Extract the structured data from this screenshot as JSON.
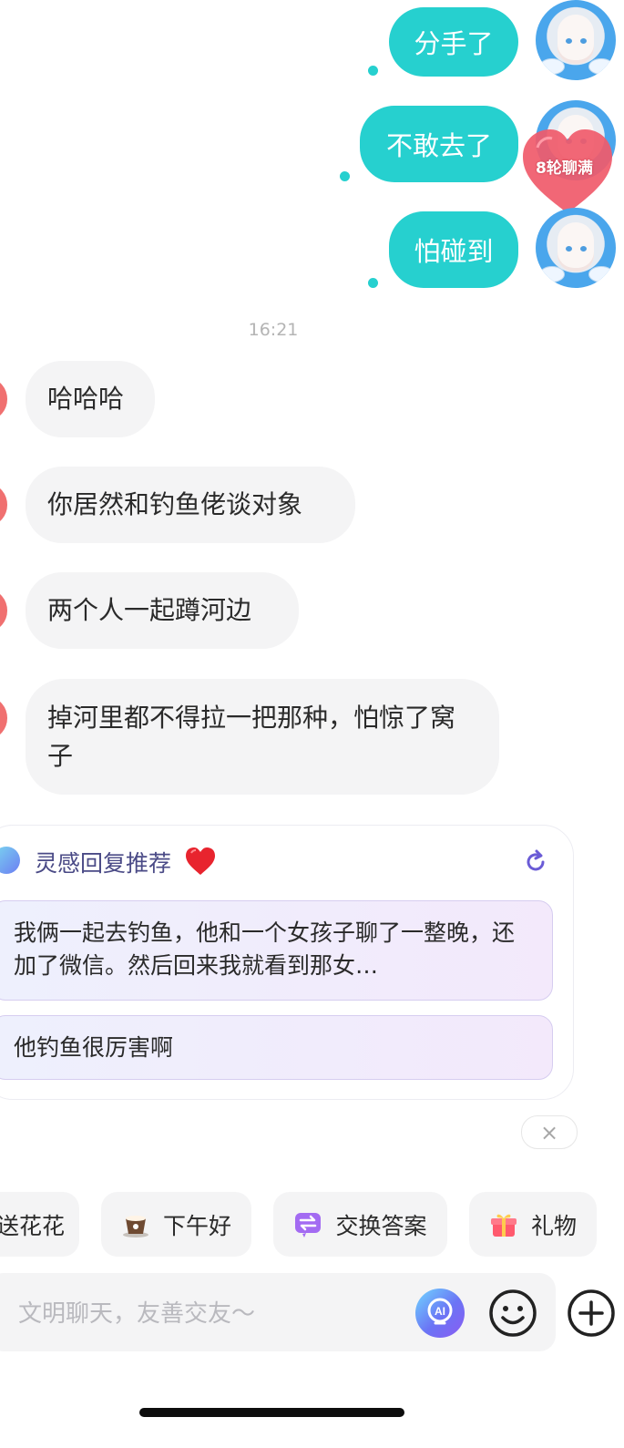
{
  "chat": {
    "outgoing": [
      {
        "text": "分手了"
      },
      {
        "text": "不敢去了"
      },
      {
        "text": "怕碰到"
      }
    ],
    "heart_badge": "8轮聊满",
    "timestamp": "16:21",
    "incoming": [
      {
        "text": "哈哈哈"
      },
      {
        "text": "你居然和钓鱼佬谈对象"
      },
      {
        "text": "两个人一起蹲河边"
      },
      {
        "text": "掉河里都不得拉一把那种，怕惊了窝子"
      }
    ]
  },
  "suggestions": {
    "title": "灵感回复推荐",
    "title_emoji": "heart",
    "items": [
      {
        "text": "我俩一起去钓鱼，他和一个女孩子聊了一整晚，还加了微信。然后回来我就看到那女…"
      },
      {
        "text": "他钓鱼很厉害啊"
      }
    ],
    "close_label": "×"
  },
  "quick_actions": [
    {
      "label": "送花花",
      "icon": "flower-icon"
    },
    {
      "label": "下午好",
      "icon": "coffee-cup-icon"
    },
    {
      "label": "交换答案",
      "icon": "exchange-icon"
    },
    {
      "label": "礼物",
      "icon": "gift-icon"
    }
  ],
  "input": {
    "placeholder": "文明聊天，友善交友～"
  },
  "colors": {
    "outgoing_bubble": "#26d0cf",
    "incoming_bubble": "#f4f4f5",
    "heart": "#f05a6a",
    "accent": "#6b74f5"
  }
}
